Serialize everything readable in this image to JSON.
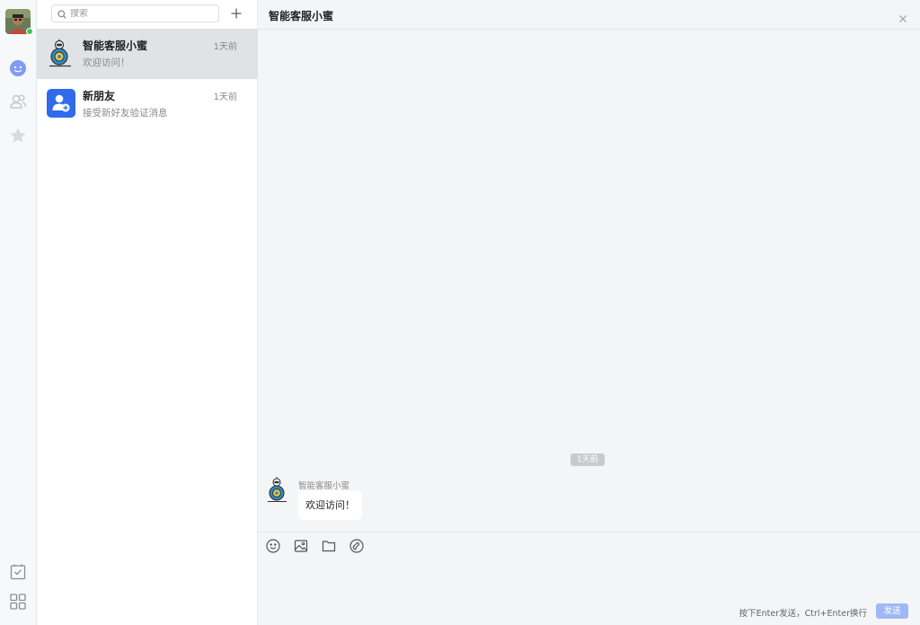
{
  "search": {
    "placeholder": "搜索"
  },
  "conversations": [
    {
      "name": "智能客服小蜜",
      "time": "1天前",
      "preview": "欢迎访问！"
    },
    {
      "name": "新朋友",
      "time": "1天前",
      "preview": "接受新好友验证消息"
    }
  ],
  "chat": {
    "title": "智能客服小蜜",
    "time_divider": "1天前",
    "messages": [
      {
        "sender": "智能客服小蜜",
        "text": "欢迎访问！"
      }
    ],
    "composer": {
      "hint": "按下Enter发送，Ctrl+Enter换行",
      "send_label": "发送"
    }
  },
  "colors": {
    "accent": "#2f6bea",
    "send_button": "#9fb8f5",
    "online": "#43c25b",
    "active_row": "#e1e2e6"
  },
  "icons": [
    "chat-icon",
    "contacts-icon",
    "star-icon",
    "todo-icon",
    "apps-icon",
    "search-icon",
    "plus-icon",
    "close-icon",
    "emoji-icon",
    "image-icon",
    "folder-icon",
    "link-icon"
  ]
}
